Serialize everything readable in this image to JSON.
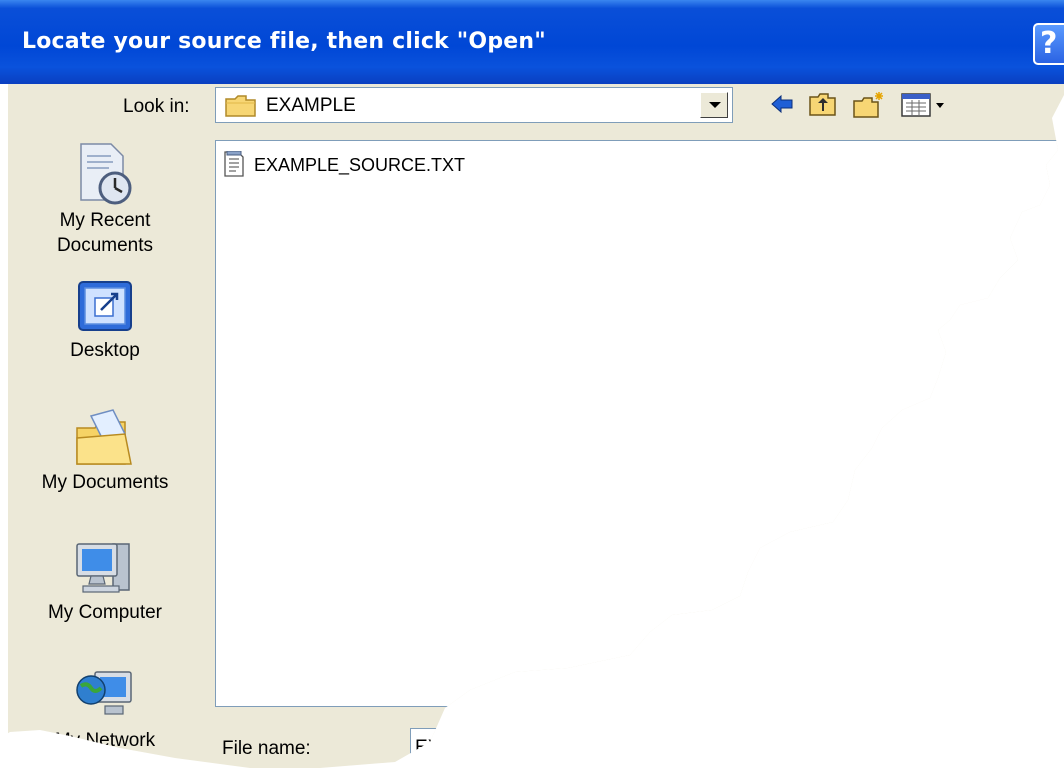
{
  "window": {
    "title": "Locate your source file, then click \"Open\"",
    "help_label": "?"
  },
  "look_in": {
    "label": "Look in:",
    "value": "EXAMPLE"
  },
  "toolbar": {
    "icons": [
      "back-icon",
      "up-folder-icon",
      "new-folder-icon",
      "view-menu-icon"
    ]
  },
  "places_bar": {
    "items": [
      {
        "label_lines": [
          "My Recent",
          "Documents"
        ],
        "icon": "recent-documents-icon"
      },
      {
        "label_lines": [
          "Desktop"
        ],
        "icon": "desktop-icon"
      },
      {
        "label_lines": [
          "My Documents"
        ],
        "icon": "my-documents-icon"
      },
      {
        "label_lines": [
          "My Computer"
        ],
        "icon": "my-computer-icon"
      },
      {
        "label_lines": [
          "My Network"
        ],
        "icon": "my-network-icon"
      }
    ]
  },
  "file_list": {
    "items": [
      {
        "name": "EXAMPLE_SOURCE.TXT",
        "icon": "text-file-icon"
      }
    ]
  },
  "file_name": {
    "label": "File name:",
    "value": "EXAMPLE_SOURCE.TXT"
  },
  "colors": {
    "titlebar": "#0047d6",
    "client": "#ece9d8",
    "border": "#7f9db9"
  }
}
